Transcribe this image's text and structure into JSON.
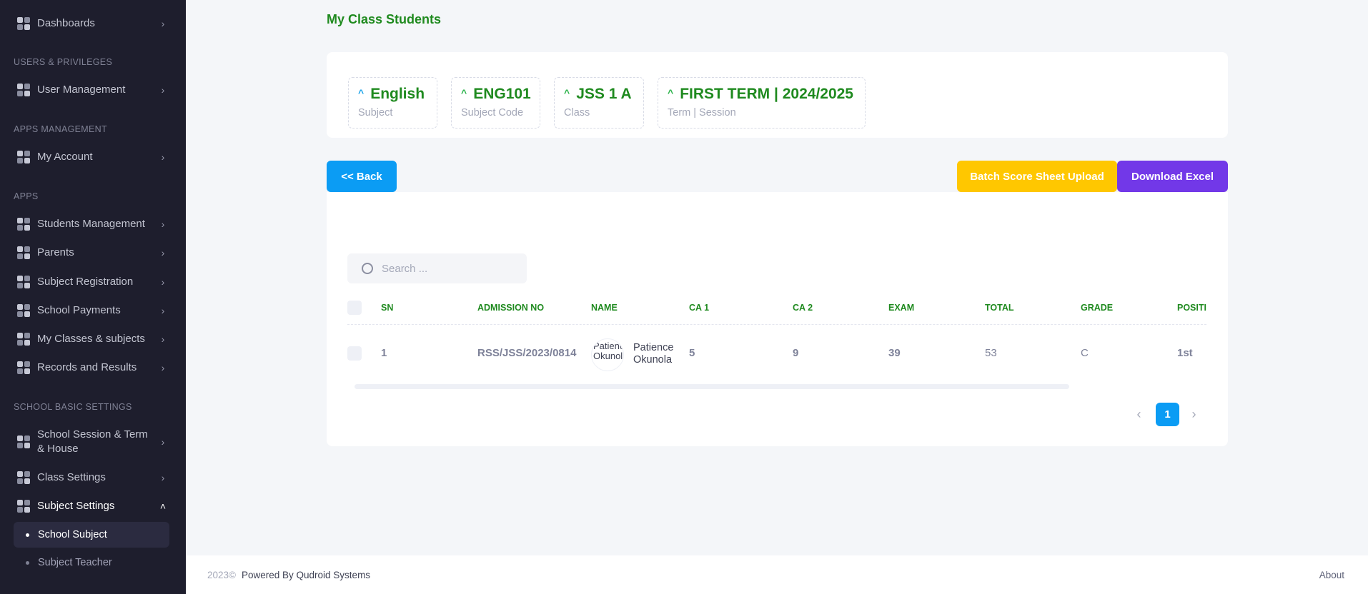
{
  "sidebar": {
    "items": [
      {
        "label": "Dashboards"
      },
      {
        "label": "User Management"
      },
      {
        "label": "My Account"
      },
      {
        "label": "Students Management"
      },
      {
        "label": "Parents"
      },
      {
        "label": "Subject Registration"
      },
      {
        "label": "School Payments"
      },
      {
        "label": "My Classes & subjects"
      },
      {
        "label": "Records and Results"
      },
      {
        "label": "School Session & Term & House"
      },
      {
        "label": "Class Settings"
      },
      {
        "label": "Subject Settings"
      }
    ],
    "sections": [
      "USERS & PRIVILEGES",
      "APPS MANAGEMENT",
      "APPS",
      "SCHOOL BASIC SETTINGS"
    ],
    "subitems": [
      {
        "label": "School Subject",
        "active": true
      },
      {
        "label": "Subject Teacher",
        "active": false
      }
    ],
    "icons": {
      "item": "grid-icon",
      "chevron_right": "chevron-right-icon",
      "chevron_up": "chevron-up-icon"
    }
  },
  "page": {
    "title": "My Class Students"
  },
  "info": [
    {
      "value": "English",
      "label": "Subject"
    },
    {
      "value": "ENG101",
      "label": "Subject Code"
    },
    {
      "value": "JSS 1 A",
      "label": "Class"
    },
    {
      "value": "FIRST TERM | 2024/2025",
      "label": "Term | Session"
    }
  ],
  "buttons": {
    "back": "<< Back",
    "batch": "Batch Score Sheet Upload",
    "excel": "Download Excel"
  },
  "search": {
    "placeholder": "Search ..."
  },
  "table": {
    "headers": [
      "SN",
      "ADMISSION NO",
      "NAME",
      "CA 1",
      "CA 2",
      "EXAM",
      "TOTAL",
      "GRADE",
      "POSITI"
    ],
    "rows": [
      {
        "sn": "1",
        "admission_no": "RSS/JSS/2023/0814",
        "avatar_alt": "Patience Okunola",
        "name_line1": "Patience",
        "name_line2": "Okunola",
        "ca1": "5",
        "ca2": "9",
        "exam": "39",
        "total": "53",
        "grade": "C",
        "position": "1st"
      }
    ]
  },
  "pagination": {
    "current": "1",
    "prev": "‹",
    "next": "›"
  },
  "footer": {
    "year": "2023©",
    "powered": "Powered By Qudroid Systems",
    "about": "About"
  },
  "colors": {
    "sidebar_bg": "#1e1e2d",
    "accent_green": "#1f8a1f",
    "primary": "#0b9cf4",
    "warning": "#ffc700",
    "purple": "#7238e8"
  }
}
